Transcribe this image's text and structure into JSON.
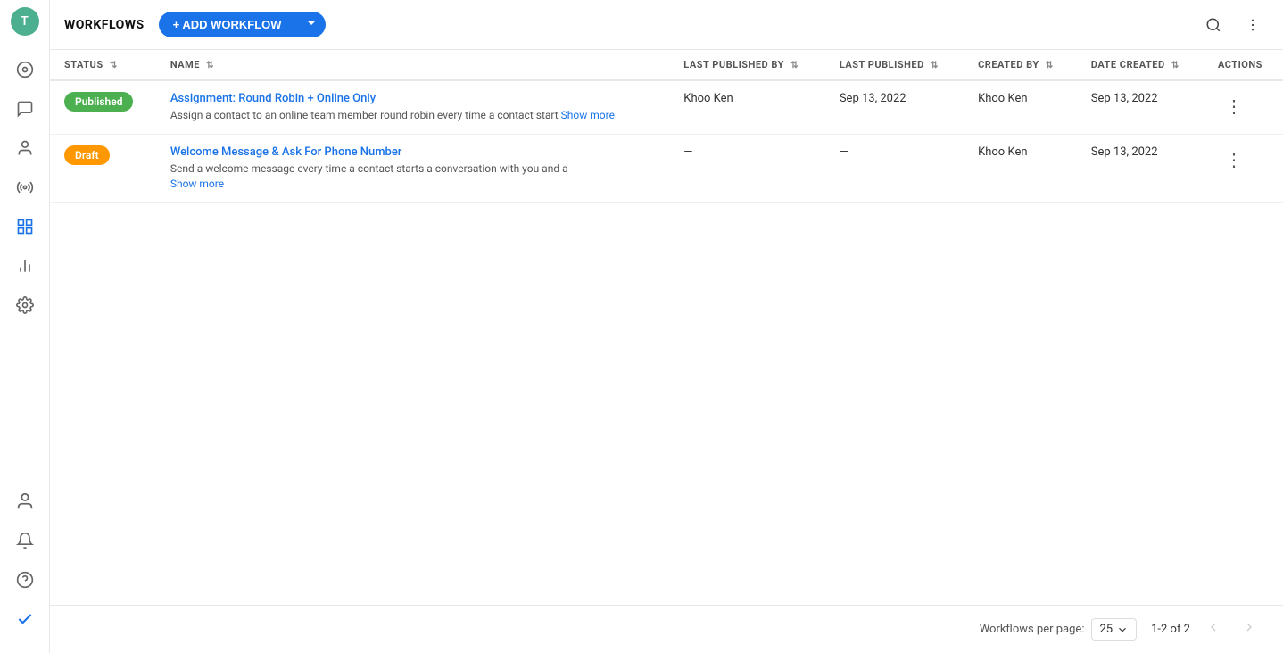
{
  "sidebar": {
    "avatar_letter": "T",
    "items": [
      {
        "name": "dashboard-icon",
        "symbol": "◉",
        "active": false
      },
      {
        "name": "chat-icon",
        "symbol": "💬",
        "active": false
      },
      {
        "name": "contacts-icon",
        "symbol": "👤",
        "active": false
      },
      {
        "name": "broadcast-icon",
        "symbol": "📡",
        "active": false
      },
      {
        "name": "workflows-icon",
        "symbol": "⚙",
        "active": true
      },
      {
        "name": "reports-icon",
        "symbol": "📊",
        "active": false
      },
      {
        "name": "settings-icon",
        "symbol": "⚙️",
        "active": false
      }
    ],
    "bottom_items": [
      {
        "name": "user-icon",
        "symbol": "👤"
      },
      {
        "name": "notifications-icon",
        "symbol": "🔔"
      },
      {
        "name": "help-icon",
        "symbol": "❓"
      },
      {
        "name": "check-icon",
        "symbol": "✔"
      }
    ]
  },
  "topbar": {
    "title": "WORKFLOWS",
    "add_button_label": "+ ADD WORKFLOW",
    "search_title": "Search",
    "more_title": "More options"
  },
  "table": {
    "columns": [
      {
        "key": "status",
        "label": "STATUS"
      },
      {
        "key": "name",
        "label": "NAME"
      },
      {
        "key": "last_published_by",
        "label": "LAST PUBLISHED BY"
      },
      {
        "key": "last_published",
        "label": "LAST PUBLISHED"
      },
      {
        "key": "created_by",
        "label": "CREATED BY"
      },
      {
        "key": "date_created",
        "label": "DATE CREATED"
      },
      {
        "key": "actions",
        "label": "ACTIONS"
      }
    ],
    "rows": [
      {
        "status": "Published",
        "status_type": "published",
        "name": "Assignment: Round Robin + Online Only",
        "description": "Assign a contact to an online team member round robin every time a contact start",
        "show_more": "Show more",
        "last_published_by": "Khoo Ken",
        "last_published": "Sep 13, 2022",
        "created_by": "Khoo Ken",
        "date_created": "Sep 13, 2022"
      },
      {
        "status": "Draft",
        "status_type": "draft",
        "name": "Welcome Message & Ask For Phone Number",
        "description": "Send a welcome message every time a contact starts a conversation with you and a",
        "show_more": "Show more",
        "last_published_by": "—",
        "last_published": "—",
        "created_by": "Khoo Ken",
        "date_created": "Sep 13, 2022"
      }
    ]
  },
  "footer": {
    "per_page_label": "Workflows per page:",
    "per_page_value": "25",
    "pagination_info": "1-2 of 2"
  }
}
